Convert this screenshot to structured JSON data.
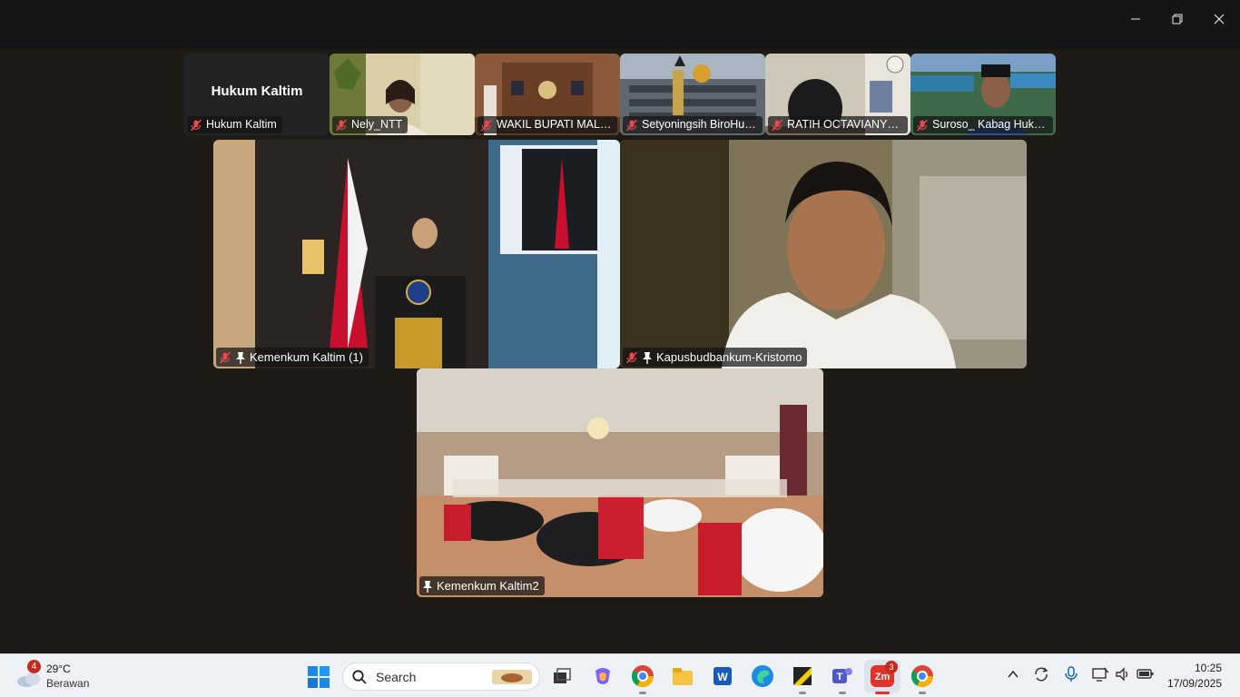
{
  "window": {
    "controls": {
      "minimize_icon": "minimize-icon",
      "restore_icon": "restore-icon",
      "close_icon": "close-icon"
    }
  },
  "gallery_top": [
    {
      "name": "Hukum Kaltim",
      "center_name": "Hukum Kaltim",
      "muted": true,
      "video": false
    },
    {
      "name": "Nely_NTT",
      "muted": true,
      "video": true
    },
    {
      "name": "WAKIL BUPATI MALIN...",
      "muted": true,
      "video": true
    },
    {
      "name": "Setyoningsih BiroHuk...",
      "muted": true,
      "video": true
    },
    {
      "name": "RATIH OCTAVIANY_BA...",
      "muted": true,
      "video": true
    },
    {
      "name": "Suroso_ Kabag Huku...",
      "muted": true,
      "video": true
    }
  ],
  "gallery_main": [
    {
      "name": "Kemenkum Kaltim (1)",
      "muted": true,
      "pinned": true
    },
    {
      "name": "Kapusbudbankum-Kristomo",
      "muted": true,
      "pinned": true
    },
    {
      "name": "Kemenkum Kaltim2",
      "muted": false,
      "pinned": true,
      "active_speaker": true
    }
  ],
  "colors": {
    "active_speaker": "#3bd67c",
    "muted_icon": "#e5484d"
  },
  "taskbar": {
    "weather": {
      "badge": "4",
      "temp": "29°C",
      "desc": "Berawan"
    },
    "search_label": "Search",
    "zoom_badge": "3",
    "apps": [
      "task-view-icon",
      "copilot-icon",
      "chrome-icon",
      "file-explorer-icon",
      "word-icon",
      "edge-icon",
      "sticky-notes-icon",
      "teams-icon",
      "zoom-icon",
      "chrome-profile-icon"
    ],
    "clock": {
      "time": "10:25",
      "date": "17/09/2025"
    }
  }
}
